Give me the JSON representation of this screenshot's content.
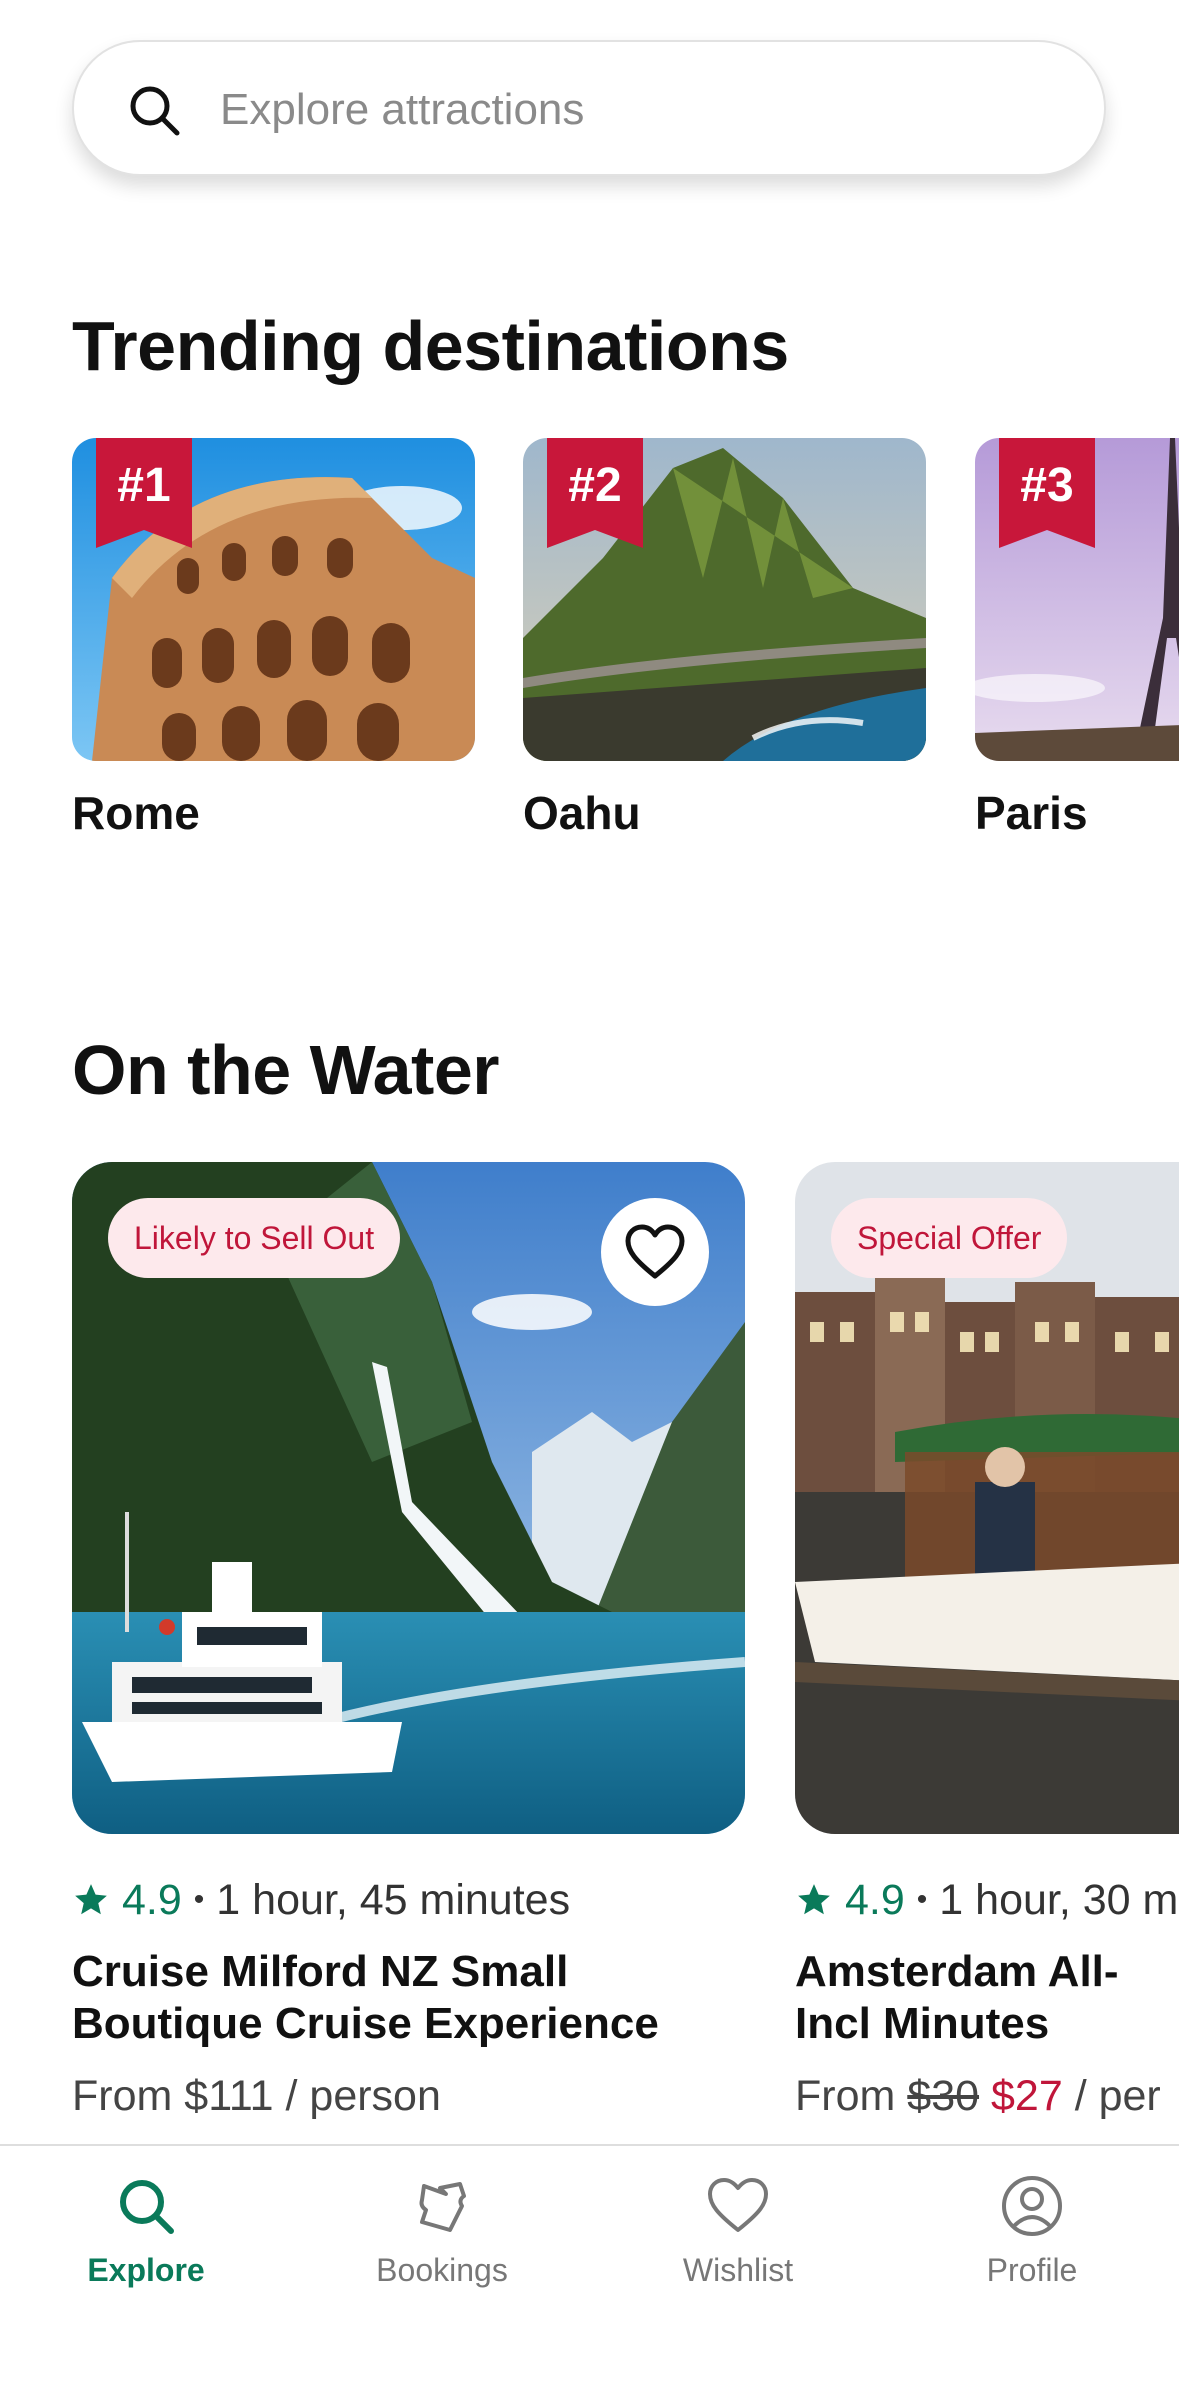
{
  "search": {
    "placeholder": "Explore attractions"
  },
  "trending": {
    "title": "Trending destinations",
    "items": [
      {
        "rank": "#1",
        "name": "Rome"
      },
      {
        "rank": "#2",
        "name": "Oahu"
      },
      {
        "rank": "#3",
        "name": "Paris"
      }
    ]
  },
  "water": {
    "title": "On the Water",
    "tours": [
      {
        "badge": "Likely to Sell Out",
        "rating": "4.9",
        "separator": "•",
        "duration": "1 hour, 45 minutes",
        "title": "Cruise Milford NZ Small Boutique Cruise Experience",
        "price_prefix": "From",
        "price": "$111",
        "price_suffix": "/ person"
      },
      {
        "badge": "Special Offer",
        "rating": "4.9",
        "separator": "•",
        "duration": "1 hour, 30 m",
        "title": "Amsterdam All-Incl Minutes Heated Cr",
        "price_prefix": "From",
        "price_old": "$30",
        "price_sale": "$27",
        "price_suffix": "/ per"
      }
    ]
  },
  "nav": {
    "items": [
      {
        "label": "Explore",
        "icon": "search-icon",
        "active": true
      },
      {
        "label": "Bookings",
        "icon": "ticket-icon",
        "active": false
      },
      {
        "label": "Wishlist",
        "icon": "heart-icon",
        "active": false
      },
      {
        "label": "Profile",
        "icon": "profile-icon",
        "active": false
      }
    ]
  },
  "colors": {
    "accent": "#0a7a5a",
    "badge_red": "#c8173a",
    "pill_bg": "#fde9ec",
    "pill_text": "#c0163a",
    "star": "#0a7a5a"
  }
}
